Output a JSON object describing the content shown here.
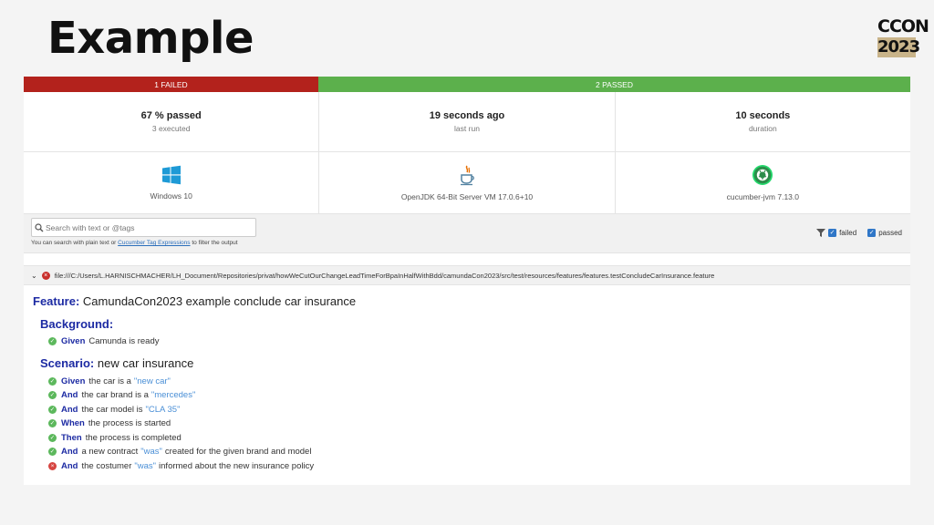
{
  "slide": {
    "title": "Example",
    "logo_line1": "CCON",
    "logo_line2": "2023"
  },
  "summary_bar": {
    "failed_label": "1 FAILED",
    "passed_label": "2 PASSED",
    "failed_color": "#b3221c",
    "passed_color": "#5cb04c"
  },
  "stats": [
    {
      "main": "67 % passed",
      "sub": "3 executed"
    },
    {
      "main": "19 seconds ago",
      "sub": "last run"
    },
    {
      "main": "10 seconds",
      "sub": "duration"
    }
  ],
  "environment": {
    "os": {
      "label": "Windows 10",
      "icon": "windows-icon"
    },
    "jvm": {
      "label": "OpenJDK 64-Bit Server VM 17.0.6+10",
      "icon": "java-icon"
    },
    "runner": {
      "label": "cucumber-jvm 7.13.0",
      "icon": "cucumber-icon"
    }
  },
  "search": {
    "placeholder": "Search with text or @tags",
    "hint_before": "You can search with plain text or",
    "hint_link": "Cucumber Tag Expressions",
    "hint_after": "to filter the output"
  },
  "filters": {
    "failed": "failed",
    "passed": "passed"
  },
  "file_path": "file:///C:/Users/L.HARNISCHMACHER/LH_Document/Repositories/privat/howWeCutOurChangeLeadTimeForBpaInHalfWithBdd/camundaCon2023/src/test/resources/features/features.testConcludeCarInsurance.feature",
  "feature": {
    "keyword": "Feature:",
    "name": "CamundaCon2023 example conclude car insurance",
    "background": {
      "keyword": "Background:",
      "steps": [
        {
          "kw": "Given",
          "text": "Camunda is ready"
        }
      ]
    },
    "scenario": {
      "keyword": "Scenario:",
      "name": "new car insurance",
      "steps": [
        {
          "kw": "Given",
          "pre": "the car is a",
          "arg": "\"new car\"",
          "post": ""
        },
        {
          "kw": "And",
          "pre": "the car brand is a",
          "arg": "\"mercedes\"",
          "post": ""
        },
        {
          "kw": "And",
          "pre": "the car model is",
          "arg": "\"CLA 35\"",
          "post": ""
        },
        {
          "kw": "When",
          "pre": "the process is started",
          "arg": "",
          "post": ""
        },
        {
          "kw": "Then",
          "pre": "the process is completed",
          "arg": "",
          "post": ""
        },
        {
          "kw": "And",
          "pre": "a new contract",
          "arg": "\"was\"",
          "post": "created for the given brand and model"
        },
        {
          "kw": "And",
          "pre": "the costumer",
          "arg": "\"was\"",
          "post": "informed about the new insurance policy"
        }
      ]
    }
  }
}
